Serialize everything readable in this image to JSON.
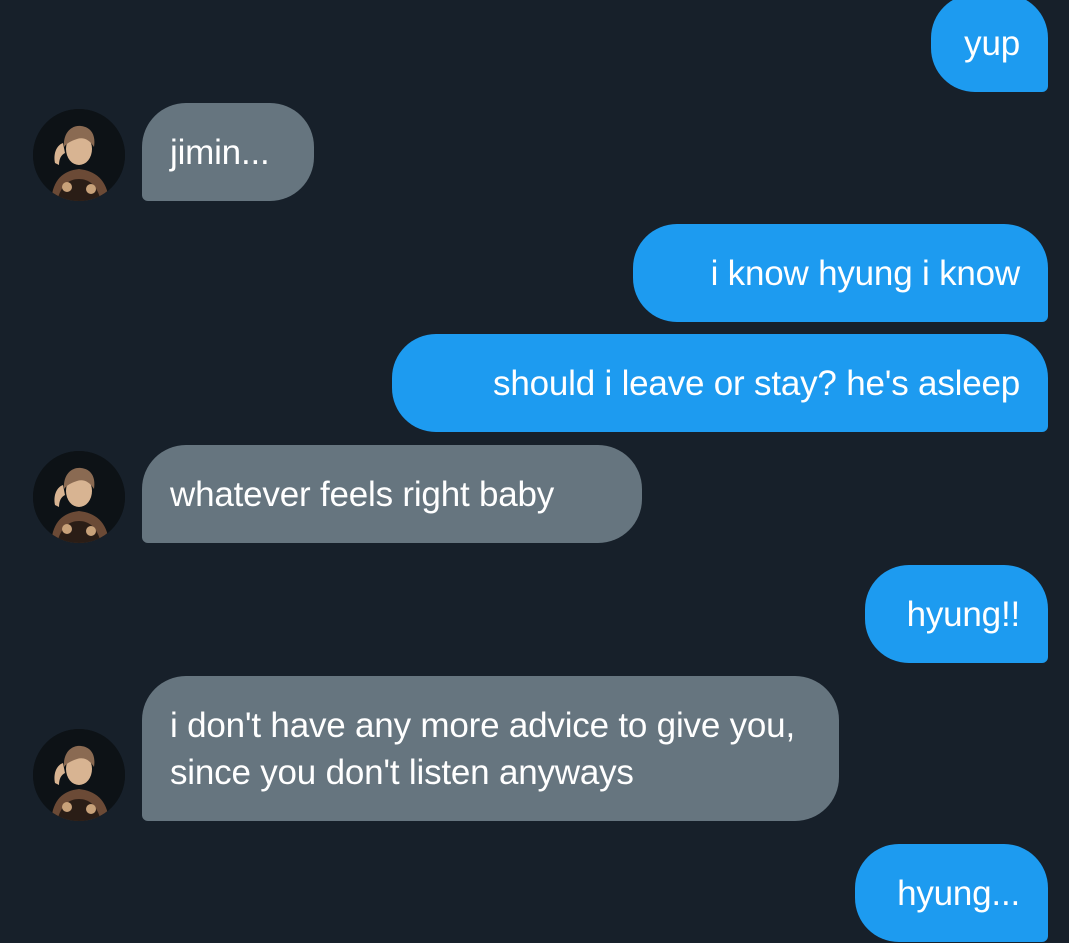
{
  "messages": [
    {
      "id": "m1",
      "direction": "sent",
      "text": "yup"
    },
    {
      "id": "m2",
      "direction": "received",
      "text": "jimin..."
    },
    {
      "id": "m3",
      "direction": "sent",
      "text": "i know hyung i know"
    },
    {
      "id": "m4",
      "direction": "sent",
      "text": "should i leave or stay? he's asleep"
    },
    {
      "id": "m5",
      "direction": "received",
      "text": "whatever feels right baby"
    },
    {
      "id": "m6",
      "direction": "sent",
      "text": "hyung!!"
    },
    {
      "id": "m7",
      "direction": "received",
      "text": "i don't have any more advice to give you, since you don't listen anyways"
    },
    {
      "id": "m8",
      "direction": "sent",
      "text": "hyung..."
    }
  ],
  "colors": {
    "background": "#17202a",
    "sent_bubble": "#1d9bf0",
    "received_bubble": "#66757f",
    "text": "#ffffff"
  },
  "icons": {
    "contact_avatar": "contact-avatar-photo"
  }
}
